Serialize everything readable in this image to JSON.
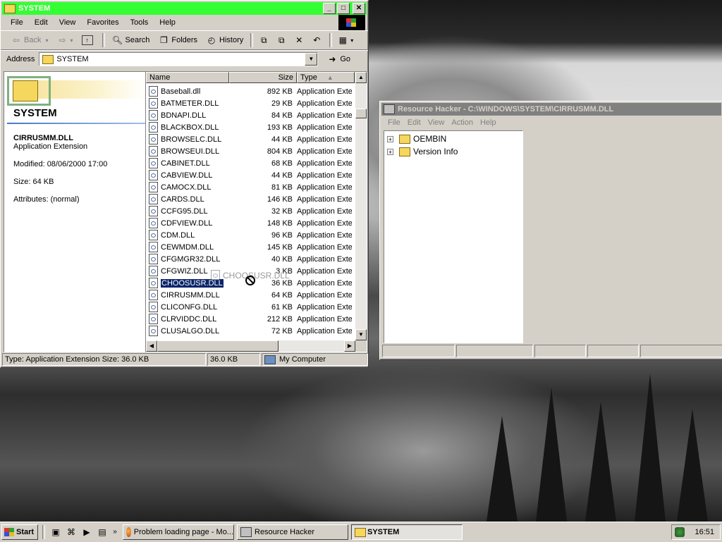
{
  "explorer": {
    "title": "SYSTEM",
    "menu": [
      "File",
      "Edit",
      "View",
      "Favorites",
      "Tools",
      "Help"
    ],
    "toolbar": {
      "back": "Back",
      "search": "Search",
      "folders": "Folders",
      "history": "History"
    },
    "address_label": "Address",
    "address_value": "SYSTEM",
    "go_label": "Go",
    "webview": {
      "folder_title": "SYSTEM",
      "selected_name": "CIRRUSMM.DLL",
      "selected_type": "Application Extension",
      "modified": "Modified: 08/06/2000 17:00",
      "size": "Size: 64 KB",
      "attributes": "Attributes: (normal)"
    },
    "columns": {
      "name": "Name",
      "size": "Size",
      "type": "Type"
    },
    "files": [
      {
        "name": "Baseball.dll",
        "size": "892 KB",
        "type": "Application Exte"
      },
      {
        "name": "BATMETER.DLL",
        "size": "29 KB",
        "type": "Application Exte"
      },
      {
        "name": "BDNAPI.DLL",
        "size": "84 KB",
        "type": "Application Exte"
      },
      {
        "name": "BLACKBOX.DLL",
        "size": "193 KB",
        "type": "Application Exte"
      },
      {
        "name": "BROWSELC.DLL",
        "size": "44 KB",
        "type": "Application Exte"
      },
      {
        "name": "BROWSEUI.DLL",
        "size": "804 KB",
        "type": "Application Exte"
      },
      {
        "name": "CABINET.DLL",
        "size": "68 KB",
        "type": "Application Exte"
      },
      {
        "name": "CABVIEW.DLL",
        "size": "44 KB",
        "type": "Application Exte"
      },
      {
        "name": "CAMOCX.DLL",
        "size": "81 KB",
        "type": "Application Exte"
      },
      {
        "name": "CARDS.DLL",
        "size": "146 KB",
        "type": "Application Exte"
      },
      {
        "name": "CCFG95.DLL",
        "size": "32 KB",
        "type": "Application Exte"
      },
      {
        "name": "CDFVIEW.DLL",
        "size": "148 KB",
        "type": "Application Exte"
      },
      {
        "name": "CDM.DLL",
        "size": "96 KB",
        "type": "Application Exte"
      },
      {
        "name": "CEWMDM.DLL",
        "size": "145 KB",
        "type": "Application Exte"
      },
      {
        "name": "CFGMGR32.DLL",
        "size": "40 KB",
        "type": "Application Exte"
      },
      {
        "name": "CFGWIZ.DLL",
        "size": "3 KB",
        "type": "Application Exte"
      },
      {
        "name": "CHOOSUSR.DLL",
        "size": "36 KB",
        "type": "Application Exte",
        "selected": true
      },
      {
        "name": "CIRRUSMM.DLL",
        "size": "64 KB",
        "type": "Application Exte"
      },
      {
        "name": "CLICONFG.DLL",
        "size": "61 KB",
        "type": "Application Exte"
      },
      {
        "name": "CLRVIDDC.DLL",
        "size": "212 KB",
        "type": "Application Exte"
      },
      {
        "name": "CLUSALGO.DLL",
        "size": "72 KB",
        "type": "Application Exte"
      }
    ],
    "drag_ghost": "CHOOSUSR.DLL",
    "status": {
      "info": "Type: Application Extension Size: 36.0 KB",
      "size": "36.0 KB",
      "zone": "My Computer"
    }
  },
  "reshacker": {
    "title": "Resource Hacker  -  C:\\WINDOWS\\SYSTEM\\CIRRUSMM.DLL",
    "menu": [
      "File",
      "Edit",
      "View",
      "Action",
      "Help"
    ],
    "tree": [
      "OEMBIN",
      "Version Info"
    ]
  },
  "taskbar": {
    "start": "Start",
    "tasks": [
      "Problem loading page - Mo...",
      "Resource Hacker",
      "SYSTEM"
    ],
    "clock": "16:51"
  },
  "colors": {
    "active_title": "#33ff33",
    "inactive_title": "#808080",
    "selection": "#0a246a",
    "face": "#d4d0c8"
  }
}
